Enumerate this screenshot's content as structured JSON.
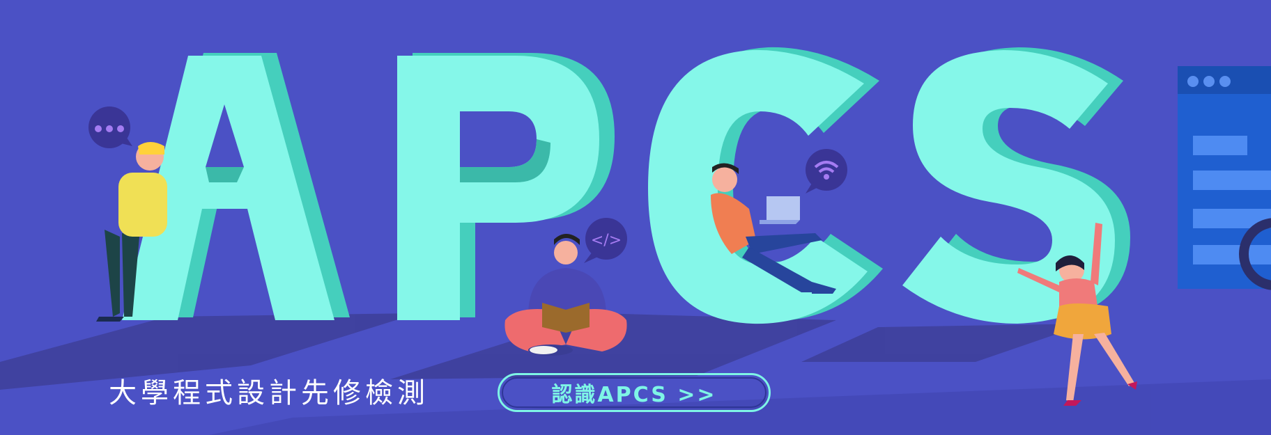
{
  "banner": {
    "subtitle": "大學程式設計先修檢測",
    "cta_label": "認識APCS >>",
    "hero_letters": [
      "A",
      "P",
      "C",
      "S"
    ],
    "code_bubble": "</>"
  },
  "colors": {
    "background": "#4b51c5",
    "letter_face": "#85f7e9",
    "letter_side": "#45cfbd",
    "accent": "#7ef5e6",
    "bubble": "#3a3596",
    "window": "#1f5fd0"
  },
  "icons": [
    "chat-bubble-icon",
    "code-bubble-icon",
    "wifi-bubble-icon",
    "laptop-icon",
    "book-icon",
    "browser-window-icon",
    "magnifier-icon"
  ]
}
